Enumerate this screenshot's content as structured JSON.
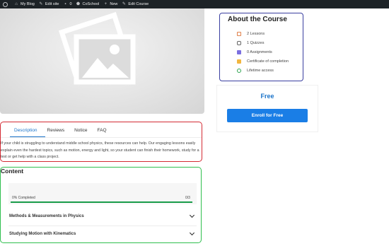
{
  "adminbar": {
    "items": [
      {
        "icon": "wordpress-icon",
        "label": ""
      },
      {
        "icon": "home-icon",
        "label": "My Blog"
      },
      {
        "icon": "brush-icon",
        "label": "Edit site"
      },
      {
        "icon": "comment-icon",
        "label": "0"
      },
      {
        "icon": "coschool-icon",
        "label": "CoSchool"
      },
      {
        "icon": "plus-icon",
        "label": "New"
      },
      {
        "icon": "pencil-icon",
        "label": "Edit Course"
      }
    ]
  },
  "about": {
    "title": "About the Course",
    "items": [
      {
        "icon": "lessons-icon",
        "label": "2 Lessons"
      },
      {
        "icon": "quizzes-icon",
        "label": "1 Quizzes"
      },
      {
        "icon": "assignments-icon",
        "label": "0 Assignments"
      },
      {
        "icon": "certificate-icon",
        "label": "Certificate of completion"
      },
      {
        "icon": "lifetime-icon",
        "label": "Lifetime access"
      }
    ]
  },
  "enroll": {
    "price": "Free",
    "button_label": "Enroll for Free"
  },
  "tabs": {
    "items": [
      "Description",
      "Reviews",
      "Notice",
      "FAQ"
    ],
    "active": "Description"
  },
  "description": {
    "text": "If your child is struggling to understand middle school physics, these resources can help. Our engaging lessons easily explain even the hardest topics, such as motion, energy and light, so your student can finish their homework, study for a test or get help with a class project."
  },
  "content": {
    "title": "Content",
    "progress": {
      "label": "0% Completed",
      "count": "0/3",
      "percent": 0
    },
    "modules": [
      {
        "title": "Methods & Measurements in Physics"
      },
      {
        "title": "Studying Motion with Kinematics"
      }
    ]
  },
  "colors": {
    "accent_blue": "#1a7ee6",
    "progress_green": "#1a9c4a",
    "highlight_red": "#d42a33",
    "highlight_navy": "#3a3fa0",
    "highlight_green": "#2fbf4e"
  }
}
